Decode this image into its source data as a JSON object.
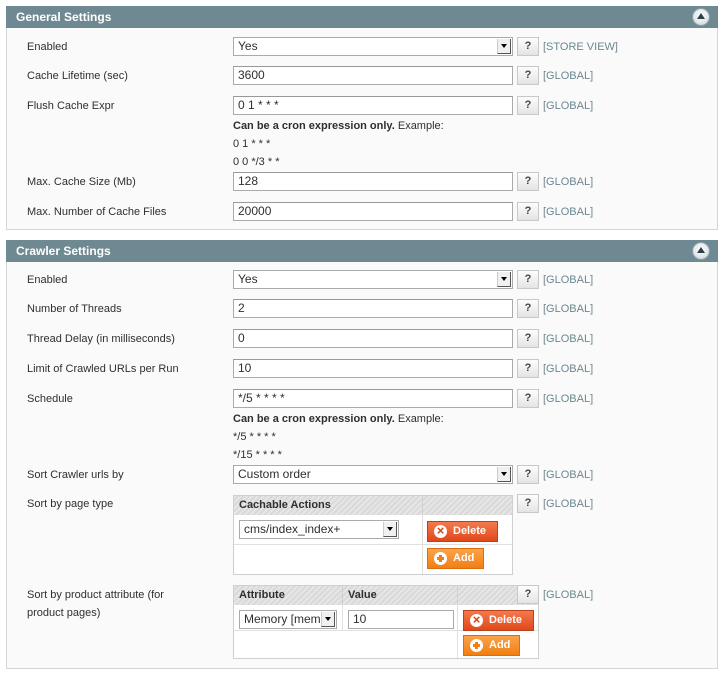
{
  "general": {
    "title": "General Settings",
    "enabled": {
      "label": "Enabled",
      "value": "Yes",
      "scope": "[STORE VIEW]"
    },
    "cache_lifetime": {
      "label": "Cache Lifetime (sec)",
      "value": "3600",
      "scope": "[GLOBAL]"
    },
    "flush_cache_expr": {
      "label": "Flush Cache Expr",
      "value": "0 1 * * *",
      "scope": "[GLOBAL]",
      "note_bold": "Can be a cron expression only.",
      "note_rest": " Example:",
      "example1": "0 1 * * *",
      "example2": "0 0 */3 * *"
    },
    "max_cache_size": {
      "label": "Max. Cache Size (Mb)",
      "value": "128",
      "scope": "[GLOBAL]"
    },
    "max_cache_files": {
      "label": "Max. Number of Cache Files",
      "value": "20000",
      "scope": "[GLOBAL]"
    }
  },
  "crawler": {
    "title": "Crawler Settings",
    "enabled": {
      "label": "Enabled",
      "value": "Yes",
      "scope": "[GLOBAL]"
    },
    "threads": {
      "label": "Number of Threads",
      "value": "2",
      "scope": "[GLOBAL]"
    },
    "thread_delay": {
      "label": "Thread Delay (in milliseconds)",
      "value": "0",
      "scope": "[GLOBAL]"
    },
    "limit_urls": {
      "label": "Limit of Crawled URLs per Run",
      "value": "10",
      "scope": "[GLOBAL]"
    },
    "schedule": {
      "label": "Schedule",
      "value": "*/5 * * * *",
      "scope": "[GLOBAL]",
      "note_bold": "Can be a cron expression only.",
      "note_rest": " Example:",
      "example1": "*/5 * * * *",
      "example2": "*/15 * * * *"
    },
    "sort_urls": {
      "label": "Sort Crawler urls by",
      "value": "Custom order",
      "scope": "[GLOBAL]"
    },
    "sort_page_type": {
      "label": "Sort by page type",
      "scope": "[GLOBAL]",
      "column": "Cachable Actions",
      "row_value": "cms/index_index+",
      "delete_label": "Delete",
      "add_label": "Add"
    },
    "sort_product_attr": {
      "label_line1": "Sort by product attribute (for",
      "label_line2": "product pages)",
      "scope": "[GLOBAL]",
      "col_attribute": "Attribute",
      "col_value": "Value",
      "row_attribute": "Memory [memc",
      "row_value": "10",
      "delete_label": "Delete",
      "add_label": "Add"
    }
  },
  "help_label": "?"
}
